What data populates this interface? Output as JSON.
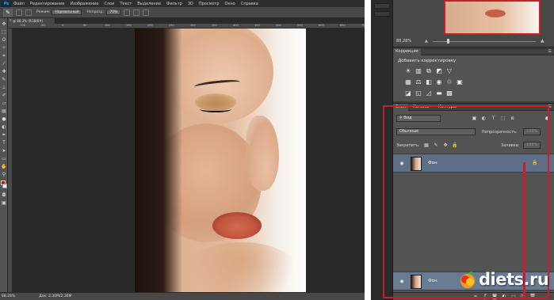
{
  "app": {
    "name": "Ps",
    "menu": [
      "Файл",
      "Редактирование",
      "Изображение",
      "Слои",
      "Текст",
      "Выделение",
      "Фильтр",
      "3D",
      "Просмотр",
      "Окно",
      "Справка"
    ]
  },
  "options_bar": {
    "mode_label": "Режим:",
    "mode_value": "Нормальный",
    "opacity_label": "Непрозр.:",
    "opacity_value": "70%"
  },
  "document": {
    "tab_label": "@ 88,3% (RGB/8#)",
    "status_zoom": "88.28%",
    "status_doc": "Док: 2,30M/2,30M"
  },
  "ruler": {
    "ticks": [
      "-100",
      "-50",
      "0",
      "50",
      "100",
      "150",
      "200",
      "250",
      "300",
      "350",
      "400",
      "450",
      "500",
      "550",
      "600",
      "650",
      "700"
    ]
  },
  "navigator": {
    "zoom": "88,28%"
  },
  "adjustments": {
    "tab": "Коррекция",
    "heading": "Добавить корректировку",
    "row1_icons": [
      "brightness-icon",
      "levels-icon",
      "curves-icon",
      "exposure-icon",
      "vibrance-icon"
    ],
    "row2_icons": [
      "hue-saturation-icon",
      "color-balance-icon",
      "black-white-icon",
      "photo-filter-icon",
      "channel-mixer-icon",
      "color-lookup-icon"
    ],
    "row3_icons": [
      "invert-icon",
      "posterize-icon",
      "threshold-icon",
      "gradient-map-icon",
      "selective-color-icon"
    ]
  },
  "layers": {
    "tabs": [
      "Слои",
      "Каналы",
      "Контуры"
    ],
    "search_placeholder": "Вид",
    "blend_mode": "Обычные",
    "opacity_label": "Непрозрачность:",
    "opacity_value": "100%",
    "lock_label": "Закрепить:",
    "fill_label": "Заливка:",
    "fill_value": "100%",
    "items": [
      {
        "name": "Фон",
        "selected": true
      },
      {
        "name": "Фон",
        "selected": false
      }
    ]
  },
  "watermark": {
    "text": "diets.ru"
  },
  "colors": {
    "accent_red": "#c8202a",
    "selected_layer": "#5d6f87"
  }
}
